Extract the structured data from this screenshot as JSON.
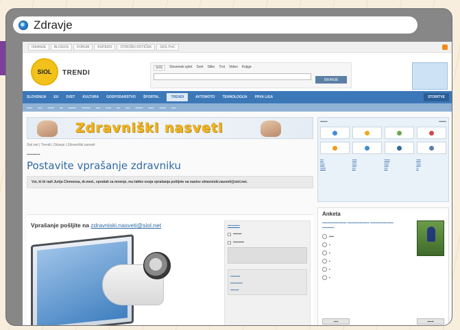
{
  "window": {
    "title": "Zdravje"
  },
  "topbar": {
    "links": [
      "ISKANJE",
      "BLOGOS",
      "FORUM",
      "KUPEDO",
      "OTROŠKI KOTIČEK",
      "SIOL PoC"
    ]
  },
  "header": {
    "logo_text": "SiOL",
    "site_name": "TRENDI",
    "search_tabs": [
      "SiOL",
      "Slovenski splet",
      "Svet",
      "Slike",
      "Trot",
      "Video",
      "Knjige"
    ],
    "search_button": "ISKANJE"
  },
  "mainnav": {
    "items": [
      "SLOVENIJA",
      "EU",
      "SVET",
      "KULTURA",
      "GOSPODARSTVO",
      "ŠPORTAL",
      "TRENDI",
      "AVTOMOTO",
      "TEHNOLOGIJA",
      "PRVA LIGA",
      "STORITVE"
    ],
    "active_index": 6
  },
  "banner": {
    "text": "Zdravniški nasveti"
  },
  "article": {
    "breadcrumb": "Siol.net  |  Trendi  |  Zdravje  |  Zdravniški nasveti",
    "headline": "Postavite vprašanje zdravniku",
    "intro": "Vsi, ki bi radi Jurija Clemensa, dr.med., vprašali za mnenje, mu lahko svoja vprašanja pošljete na naslov zdravniski.nasveti@siol.net.",
    "ask_label": "Vprašanje pošljite na",
    "ask_email": "zdravniski.nasveti@siol.net"
  },
  "poll": {
    "title": "Anketa"
  }
}
